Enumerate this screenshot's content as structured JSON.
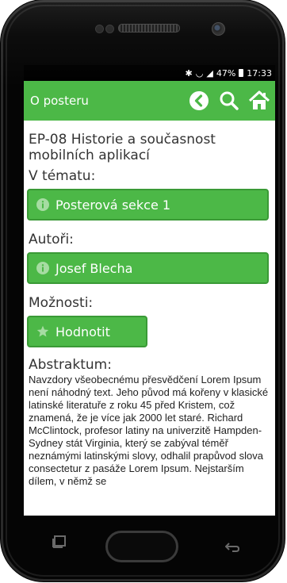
{
  "status_bar": {
    "signal": "📶",
    "battery": "47%",
    "time": "17:33"
  },
  "app_bar": {
    "title": "O posteru",
    "back_icon": "back-arrow-circle-icon",
    "search_icon": "search-icon",
    "home_icon": "home-icon"
  },
  "poster": {
    "title": "EP-08 Historie a současnost mobilních aplikací"
  },
  "topic": {
    "label": "V tématu:",
    "button": "Posterová sekce 1",
    "icon": "info-icon"
  },
  "authors": {
    "label": "Autoři:",
    "button": "Josef Blecha",
    "icon": "info-icon"
  },
  "options": {
    "label": "Možnosti:",
    "button": "Hodnotit",
    "icon": "star-icon"
  },
  "abstract": {
    "label": "Abstraktum:",
    "text": "Navzdory všeobecnému přesvědčení Lorem Ipsum není náhodný text. Jeho původ má kořeny v klasické latinské literatuře z roku 45 před Kristem, což znamená, že je více jak 2000 let staré. Richard McClintock, profesor latiny na univerzitě Hampden-Sydney stát Virginia, který se zabýval téměř neznámými latinskými slovy, odhalil prapůvod slova consectetur z pasáže Lorem Ipsum. Nejstarším dílem, v němž se"
  },
  "colors": {
    "accent": "#4cb847",
    "accent_border": "#3a9a36"
  }
}
